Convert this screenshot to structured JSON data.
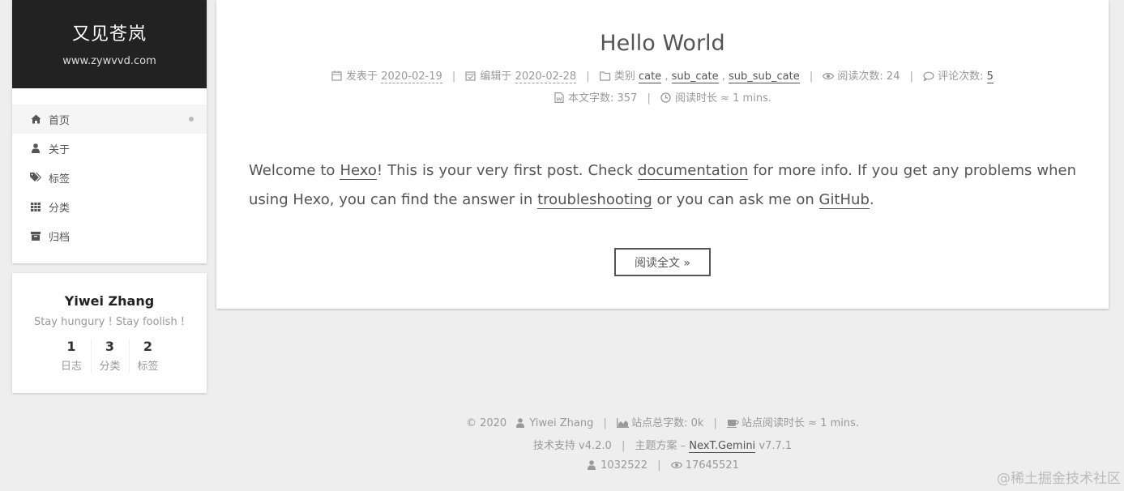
{
  "brand": {
    "title": "又见苍岚",
    "subtitle": "www.zywvvd.com"
  },
  "menu": [
    {
      "label": "首页",
      "icon": "home-icon",
      "active": true
    },
    {
      "label": "关于",
      "icon": "user-icon"
    },
    {
      "label": "标签",
      "icon": "tags-icon"
    },
    {
      "label": "分类",
      "icon": "th-icon"
    },
    {
      "label": "归档",
      "icon": "archive-icon"
    }
  ],
  "author": {
    "name": "Yiwei Zhang",
    "description": "Stay hungury ! Stay foolish !",
    "stats": [
      {
        "count": "1",
        "label": "日志"
      },
      {
        "count": "3",
        "label": "分类"
      },
      {
        "count": "2",
        "label": "标签"
      }
    ]
  },
  "post": {
    "title": "Hello World",
    "meta": {
      "posted_label": "发表于",
      "posted_date": "2020-02-19",
      "edited_label": "编辑于",
      "edited_date": "2020-02-28",
      "category_label": "类别",
      "categories": [
        "cate",
        "sub_cate",
        "sub_sub_cate"
      ],
      "views_label": "阅读次数: 24",
      "comments_label": "评论次数:",
      "comments_count": "5",
      "wordcount_label": "本文字数: 357",
      "readtime_label": "阅读时长 ≈ 1 mins."
    },
    "body": {
      "p1": "Welcome to ",
      "link_hexo": "Hexo",
      "p2": "! This is your very first post. Check ",
      "link_docs": "documentation",
      "p3": " for more info. If you get any problems when using Hexo, you can find the answer in ",
      "link_trouble": "troubleshooting",
      "p4": " or you can ask me on ",
      "link_github": "GitHub",
      "p5": "."
    },
    "readmore": "阅读全文 »"
  },
  "footer": {
    "copyright": "© 2020",
    "author": "Yiwei Zhang",
    "site_words": "站点总字数: 0k",
    "site_readtime": "站点阅读时长 ≈ 1 mins.",
    "powered_by": "技术支持 v4.2.0",
    "theme_prefix": "主题方案 –",
    "theme_link": "NexT.Gemini",
    "theme_version": "v7.7.1",
    "visitors": "1032522",
    "views": "17645521"
  },
  "watermark": "@稀土掘金技术社区"
}
